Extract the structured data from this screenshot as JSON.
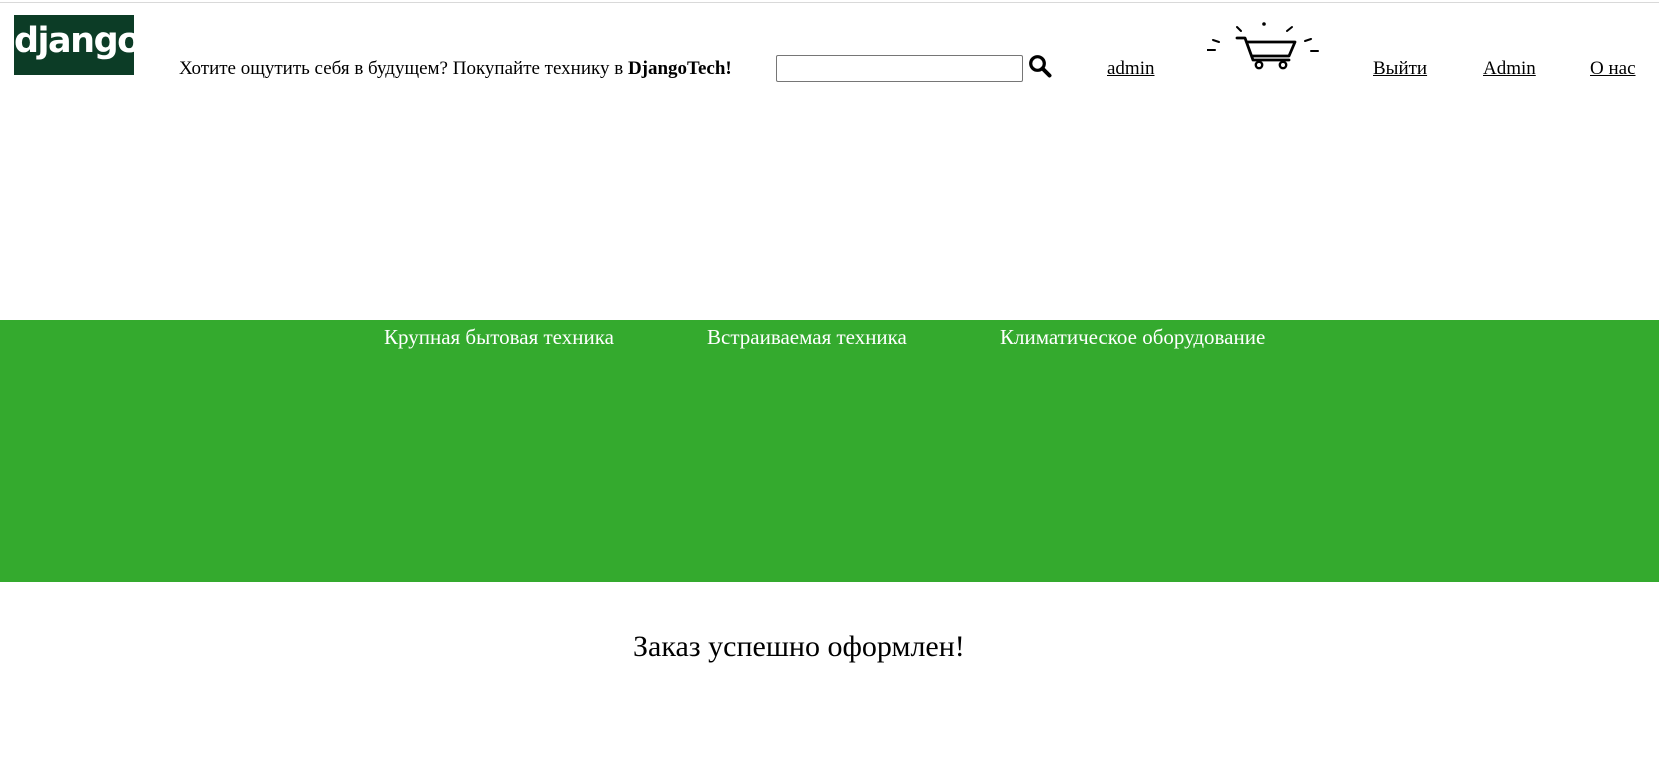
{
  "header": {
    "logo_text": "django",
    "tagline_prefix": "Хотите ощутить себя в будущем? Покупайте технику в ",
    "tagline_brand": "DjangoTech!",
    "search": {
      "value": "",
      "placeholder": "",
      "button_icon": "search-icon"
    },
    "user_link": "admin",
    "cart_icon": "cart-icon",
    "nav": {
      "logout": "Выйти",
      "admin": "Admin",
      "about": "О нас"
    }
  },
  "categories": [
    {
      "label": "Крупная бытовая техника"
    },
    {
      "label": "Встраиваемая техника"
    },
    {
      "label": "Климатическое оборудование"
    }
  ],
  "main": {
    "message": "Заказ успешно оформлен!"
  },
  "colors": {
    "logo_bg": "#0c3c26",
    "category_bar": "#34aa2e",
    "text": "#000000",
    "category_text": "#ffffff"
  }
}
